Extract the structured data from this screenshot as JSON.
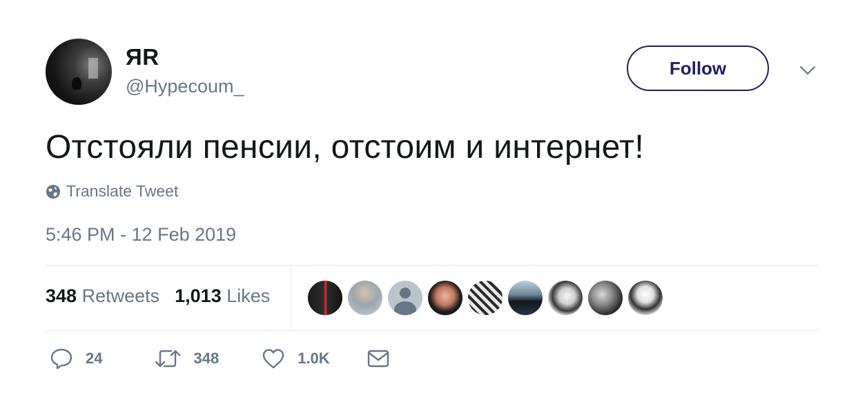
{
  "user": {
    "display_name": "ЯR",
    "handle": "@Hypecoum_"
  },
  "follow_label": "Follow",
  "tweet": {
    "text": "Отстояли пенсии, отстоим и интернет!",
    "translate_label": "Translate Tweet",
    "timestamp": "5:46 PM - 12 Feb 2019"
  },
  "stats": {
    "retweets_count": "348",
    "retweets_label": "Retweets",
    "likes_count": "1,013",
    "likes_label": "Likes"
  },
  "actions": {
    "replies": "24",
    "retweets": "348",
    "likes": "1.0K"
  },
  "colors": {
    "follow_border": "#1b2066",
    "secondary_text": "#657786",
    "primary_text": "#14171a",
    "divider": "#e1e8ed"
  },
  "icons": [
    "globe-icon",
    "chevron-down-icon",
    "reply-icon",
    "retweet-icon",
    "heart-icon",
    "envelope-icon"
  ]
}
